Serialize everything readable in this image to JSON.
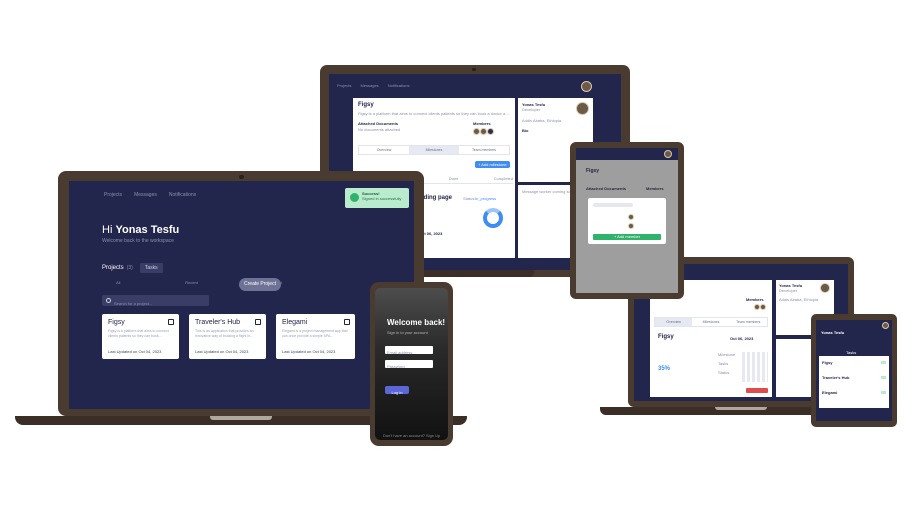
{
  "laptop_main": {
    "nav": {
      "projects": "Projects",
      "messages": "Messages",
      "notifications": "Notifications"
    },
    "toast": {
      "title": "Success!",
      "message": "Signed in successfully"
    },
    "greeting_prefix": "Hi",
    "user_name": "Yonas Tesfu",
    "welcome_text": "Welcome back to the workspace",
    "projects_label": "Projects",
    "projects_count": "(3)",
    "tasks_tab": "Tasks",
    "filter_all": "All",
    "filter_recent": "Recent",
    "filter_completed": "Completed",
    "create_project_button": "Create Project",
    "search_placeholder": "Search for a project...",
    "cards": [
      {
        "title": "Figsy",
        "description": "Figsy is a platform that aims to connect clients patients so they can book...",
        "updated": "Last Updated on Oct 04, 2023"
      },
      {
        "title": "Traveler's Hub",
        "description": "This is an application that provides an innovative way of booking a flight in...",
        "updated": "Last Updated on Oct 04, 2023"
      },
      {
        "title": "Elegami",
        "description": "Elegami is a project management app that can once provide a simple SPA...",
        "updated": "Last Updated on Oct 04, 2023"
      }
    ]
  },
  "laptop_back": {
    "nav": {
      "projects": "Projects",
      "messages": "Messages",
      "notifications": "Notifications"
    },
    "project_title": "Figsy",
    "project_desc": "Figsy is a platform that aims to connect clients patients so they can book a doctor appointment",
    "attached_docs": "Attached Documents",
    "attached_sub": "No documents attached",
    "members_label": "Members",
    "tabs": [
      "Overview",
      "Milestones",
      "Team members"
    ],
    "add_button": "+ Add milestone",
    "subtabs": [
      "Todo",
      "Done",
      "Completed"
    ],
    "milestone_title": "Landing page",
    "status_label": "Status:",
    "status_value": "In_progress",
    "due_label": "Due:",
    "due_date": "Oct 06, 2023",
    "profile_name": "Yonas Tesfu",
    "profile_role": "Developer",
    "location": "Addis Ababa, Ethiopia",
    "bio_label": "Bio",
    "message_placeholder": "Message worker coming soon..."
  },
  "tablet_left": {
    "project_title": "Figsy",
    "attached_docs": "Attached Documents",
    "members_label": "Members",
    "add_button": "+ Add member",
    "overview_tab": "Overview"
  },
  "phone": {
    "welcome": "Welcome back!",
    "subtitle": "Sign in to your account",
    "email_placeholder": "Email address",
    "password_placeholder": "Password",
    "login_button": "Log in",
    "footer": "Don't have an account? Sign Up"
  },
  "laptop_right": {
    "tabs": [
      "Overview",
      "Milestones",
      "Team members"
    ],
    "project_title": "Figsy",
    "members_label": "Members",
    "profile_name": "Yonas Tesfu",
    "profile_role": "Developer",
    "location": "Addis Ababa, Ethiopia",
    "percent": "35%",
    "due_date": "Oct 06, 2023",
    "labels": [
      "Milestone",
      "Tasks",
      "Status"
    ]
  },
  "tablet_right": {
    "user_name": "Yonas Tesfu",
    "tab": "Tasks",
    "rows": [
      "Figsy",
      "Traveler's Hub",
      "Elegami"
    ]
  },
  "colors": {
    "frame": "#4a3b30",
    "navy": "#23264c",
    "accent_blue": "#3f8df2",
    "success_green": "#b9eccd",
    "danger_red": "#e04b4b"
  }
}
